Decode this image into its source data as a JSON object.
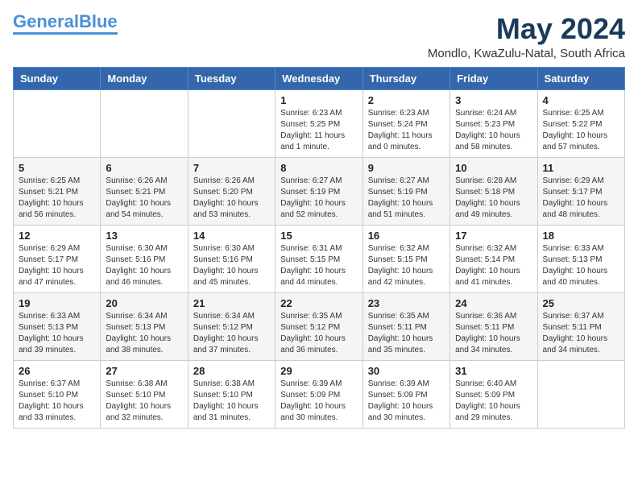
{
  "logo": {
    "general": "General",
    "blue": "Blue"
  },
  "title": "May 2024",
  "location": "Mondlo, KwaZulu-Natal, South Africa",
  "weekdays": [
    "Sunday",
    "Monday",
    "Tuesday",
    "Wednesday",
    "Thursday",
    "Friday",
    "Saturday"
  ],
  "weeks": [
    [
      {
        "day": "",
        "info": ""
      },
      {
        "day": "",
        "info": ""
      },
      {
        "day": "",
        "info": ""
      },
      {
        "day": "1",
        "info": "Sunrise: 6:23 AM\nSunset: 5:25 PM\nDaylight: 11 hours\nand 1 minute."
      },
      {
        "day": "2",
        "info": "Sunrise: 6:23 AM\nSunset: 5:24 PM\nDaylight: 11 hours\nand 0 minutes."
      },
      {
        "day": "3",
        "info": "Sunrise: 6:24 AM\nSunset: 5:23 PM\nDaylight: 10 hours\nand 58 minutes."
      },
      {
        "day": "4",
        "info": "Sunrise: 6:25 AM\nSunset: 5:22 PM\nDaylight: 10 hours\nand 57 minutes."
      }
    ],
    [
      {
        "day": "5",
        "info": "Sunrise: 6:25 AM\nSunset: 5:21 PM\nDaylight: 10 hours\nand 56 minutes."
      },
      {
        "day": "6",
        "info": "Sunrise: 6:26 AM\nSunset: 5:21 PM\nDaylight: 10 hours\nand 54 minutes."
      },
      {
        "day": "7",
        "info": "Sunrise: 6:26 AM\nSunset: 5:20 PM\nDaylight: 10 hours\nand 53 minutes."
      },
      {
        "day": "8",
        "info": "Sunrise: 6:27 AM\nSunset: 5:19 PM\nDaylight: 10 hours\nand 52 minutes."
      },
      {
        "day": "9",
        "info": "Sunrise: 6:27 AM\nSunset: 5:19 PM\nDaylight: 10 hours\nand 51 minutes."
      },
      {
        "day": "10",
        "info": "Sunrise: 6:28 AM\nSunset: 5:18 PM\nDaylight: 10 hours\nand 49 minutes."
      },
      {
        "day": "11",
        "info": "Sunrise: 6:29 AM\nSunset: 5:17 PM\nDaylight: 10 hours\nand 48 minutes."
      }
    ],
    [
      {
        "day": "12",
        "info": "Sunrise: 6:29 AM\nSunset: 5:17 PM\nDaylight: 10 hours\nand 47 minutes."
      },
      {
        "day": "13",
        "info": "Sunrise: 6:30 AM\nSunset: 5:16 PM\nDaylight: 10 hours\nand 46 minutes."
      },
      {
        "day": "14",
        "info": "Sunrise: 6:30 AM\nSunset: 5:16 PM\nDaylight: 10 hours\nand 45 minutes."
      },
      {
        "day": "15",
        "info": "Sunrise: 6:31 AM\nSunset: 5:15 PM\nDaylight: 10 hours\nand 44 minutes."
      },
      {
        "day": "16",
        "info": "Sunrise: 6:32 AM\nSunset: 5:15 PM\nDaylight: 10 hours\nand 42 minutes."
      },
      {
        "day": "17",
        "info": "Sunrise: 6:32 AM\nSunset: 5:14 PM\nDaylight: 10 hours\nand 41 minutes."
      },
      {
        "day": "18",
        "info": "Sunrise: 6:33 AM\nSunset: 5:13 PM\nDaylight: 10 hours\nand 40 minutes."
      }
    ],
    [
      {
        "day": "19",
        "info": "Sunrise: 6:33 AM\nSunset: 5:13 PM\nDaylight: 10 hours\nand 39 minutes."
      },
      {
        "day": "20",
        "info": "Sunrise: 6:34 AM\nSunset: 5:13 PM\nDaylight: 10 hours\nand 38 minutes."
      },
      {
        "day": "21",
        "info": "Sunrise: 6:34 AM\nSunset: 5:12 PM\nDaylight: 10 hours\nand 37 minutes."
      },
      {
        "day": "22",
        "info": "Sunrise: 6:35 AM\nSunset: 5:12 PM\nDaylight: 10 hours\nand 36 minutes."
      },
      {
        "day": "23",
        "info": "Sunrise: 6:35 AM\nSunset: 5:11 PM\nDaylight: 10 hours\nand 35 minutes."
      },
      {
        "day": "24",
        "info": "Sunrise: 6:36 AM\nSunset: 5:11 PM\nDaylight: 10 hours\nand 34 minutes."
      },
      {
        "day": "25",
        "info": "Sunrise: 6:37 AM\nSunset: 5:11 PM\nDaylight: 10 hours\nand 34 minutes."
      }
    ],
    [
      {
        "day": "26",
        "info": "Sunrise: 6:37 AM\nSunset: 5:10 PM\nDaylight: 10 hours\nand 33 minutes."
      },
      {
        "day": "27",
        "info": "Sunrise: 6:38 AM\nSunset: 5:10 PM\nDaylight: 10 hours\nand 32 minutes."
      },
      {
        "day": "28",
        "info": "Sunrise: 6:38 AM\nSunset: 5:10 PM\nDaylight: 10 hours\nand 31 minutes."
      },
      {
        "day": "29",
        "info": "Sunrise: 6:39 AM\nSunset: 5:09 PM\nDaylight: 10 hours\nand 30 minutes."
      },
      {
        "day": "30",
        "info": "Sunrise: 6:39 AM\nSunset: 5:09 PM\nDaylight: 10 hours\nand 30 minutes."
      },
      {
        "day": "31",
        "info": "Sunrise: 6:40 AM\nSunset: 5:09 PM\nDaylight: 10 hours\nand 29 minutes."
      },
      {
        "day": "",
        "info": ""
      }
    ]
  ]
}
